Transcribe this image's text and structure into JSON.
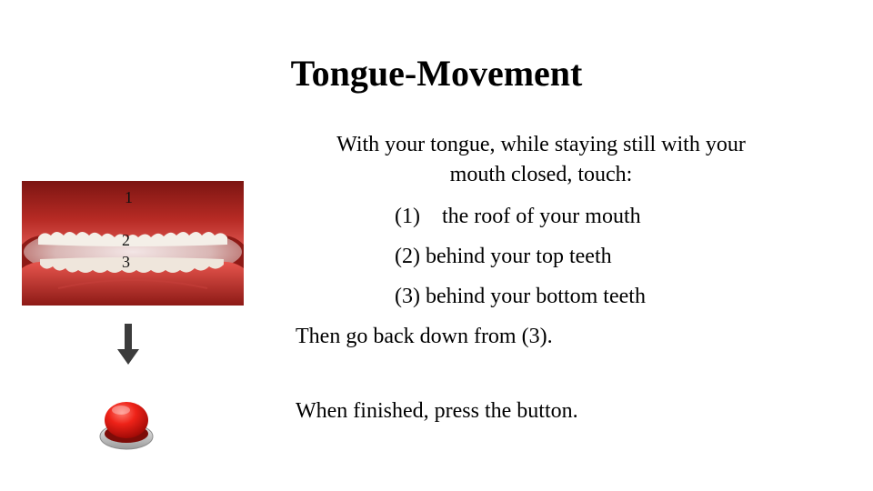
{
  "slide": {
    "title": "Tongue-Movement",
    "intro_line_1": "With your tongue, while staying still with your",
    "intro_line_2": "mouth closed, touch:",
    "steps": [
      "(1)    the roof of your mouth",
      "(2) behind your top teeth",
      "(3) behind your bottom teeth"
    ],
    "then_text": "Then go back down from (3).",
    "finish_text": "When finished, press the button."
  },
  "mouth_image": {
    "labels": [
      "1",
      "2",
      "3"
    ]
  },
  "icons": {
    "arrow": "down-arrow-icon",
    "button": "red-push-button-icon"
  },
  "colors": {
    "arrow": "#3c3c3c",
    "button_red": "#e0120f",
    "mouth_red": "#b3231f"
  }
}
